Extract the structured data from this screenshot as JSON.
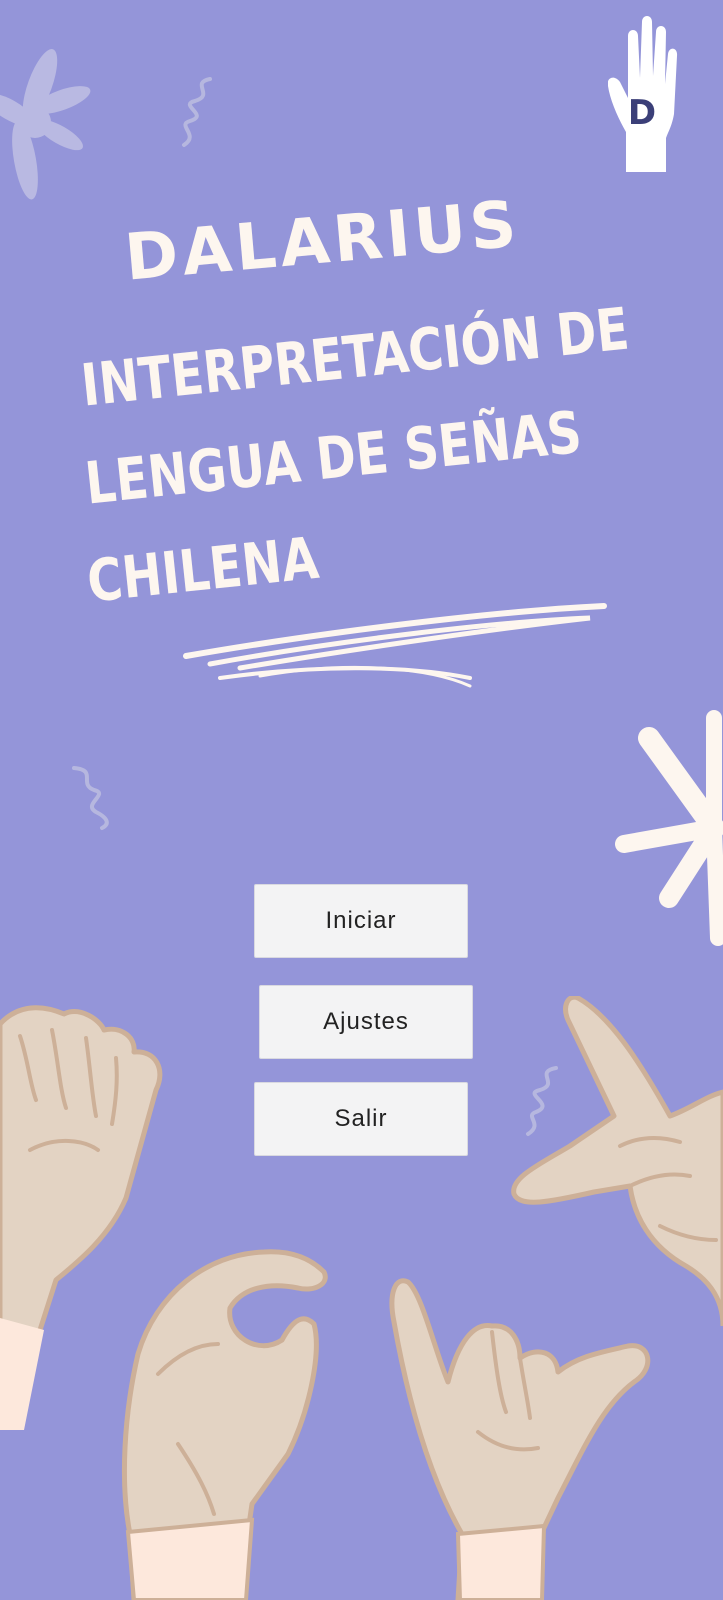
{
  "app": {
    "brand": "DALARIUS",
    "subtitle_line1": "INTERPRETACIÓN DE",
    "subtitle_line2": "LENGUA  DE  SEÑAS",
    "subtitle_line3": "CHILENA",
    "logo_letter": "D"
  },
  "menu": {
    "start_label": "Iniciar",
    "settings_label": "Ajustes",
    "exit_label": "Salir"
  },
  "colors": {
    "background": "#9495d9",
    "title": "#fdf6ef",
    "button": "#f3f3f4",
    "skin": "#e3d3c3",
    "logo_dark": "#3b3f78"
  },
  "icons": [
    "hand-logo-icon",
    "flower-icon",
    "squiggle-icon",
    "star-burst-icon",
    "hand-sign-icon"
  ]
}
